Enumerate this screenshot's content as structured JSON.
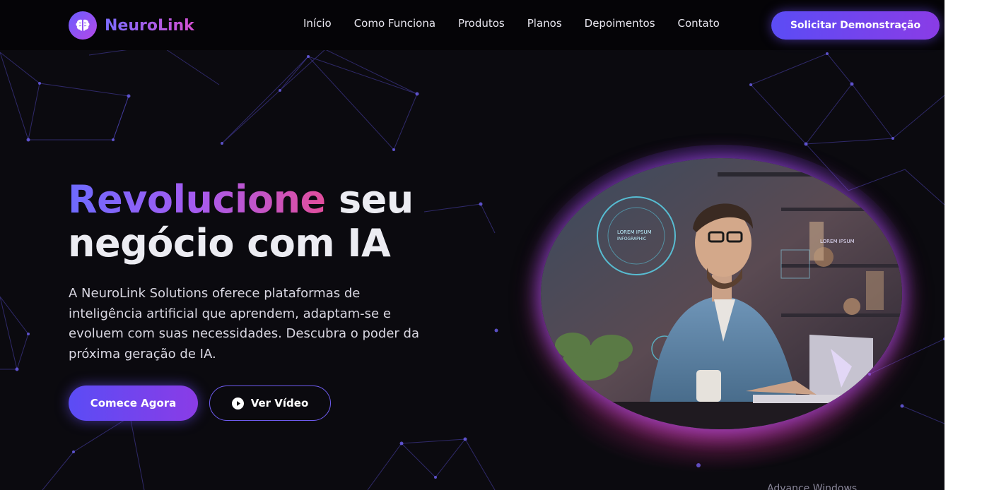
{
  "nav": {
    "brand": "NeuroLink",
    "menu": [
      "Início",
      "Como Funciona",
      "Produtos",
      "Planos",
      "Depoimentos",
      "Contato"
    ],
    "cta": "Solicitar Demonstração",
    "icons": {
      "logo": "brain-icon"
    }
  },
  "hero": {
    "title_highlight": "Revolucione",
    "title_rest_1": " seu",
    "title_line_2": "negócio com IA",
    "description": "A NeuroLink Solutions oferece plataformas de inteligência artificial que aprendem, adaptam-se e evoluem com suas necessidades. Descubra o poder da próxima geração de IA.",
    "primary_button": "Comece Agora",
    "secondary_button": "Ver Vídeo",
    "image_overlay_labels": [
      "LOREM IPSUM",
      "INFOGRAPHIC",
      "LOREM IPSUM"
    ],
    "icons": {
      "secondary_button": "play-circle-icon"
    }
  },
  "colors": {
    "background": "#0b0a0f",
    "accent_primary": "#5b4cf5",
    "accent_secondary": "#8a3ce6",
    "accent_pink": "#e24e9c"
  },
  "clipped_text": "Advance Windows"
}
